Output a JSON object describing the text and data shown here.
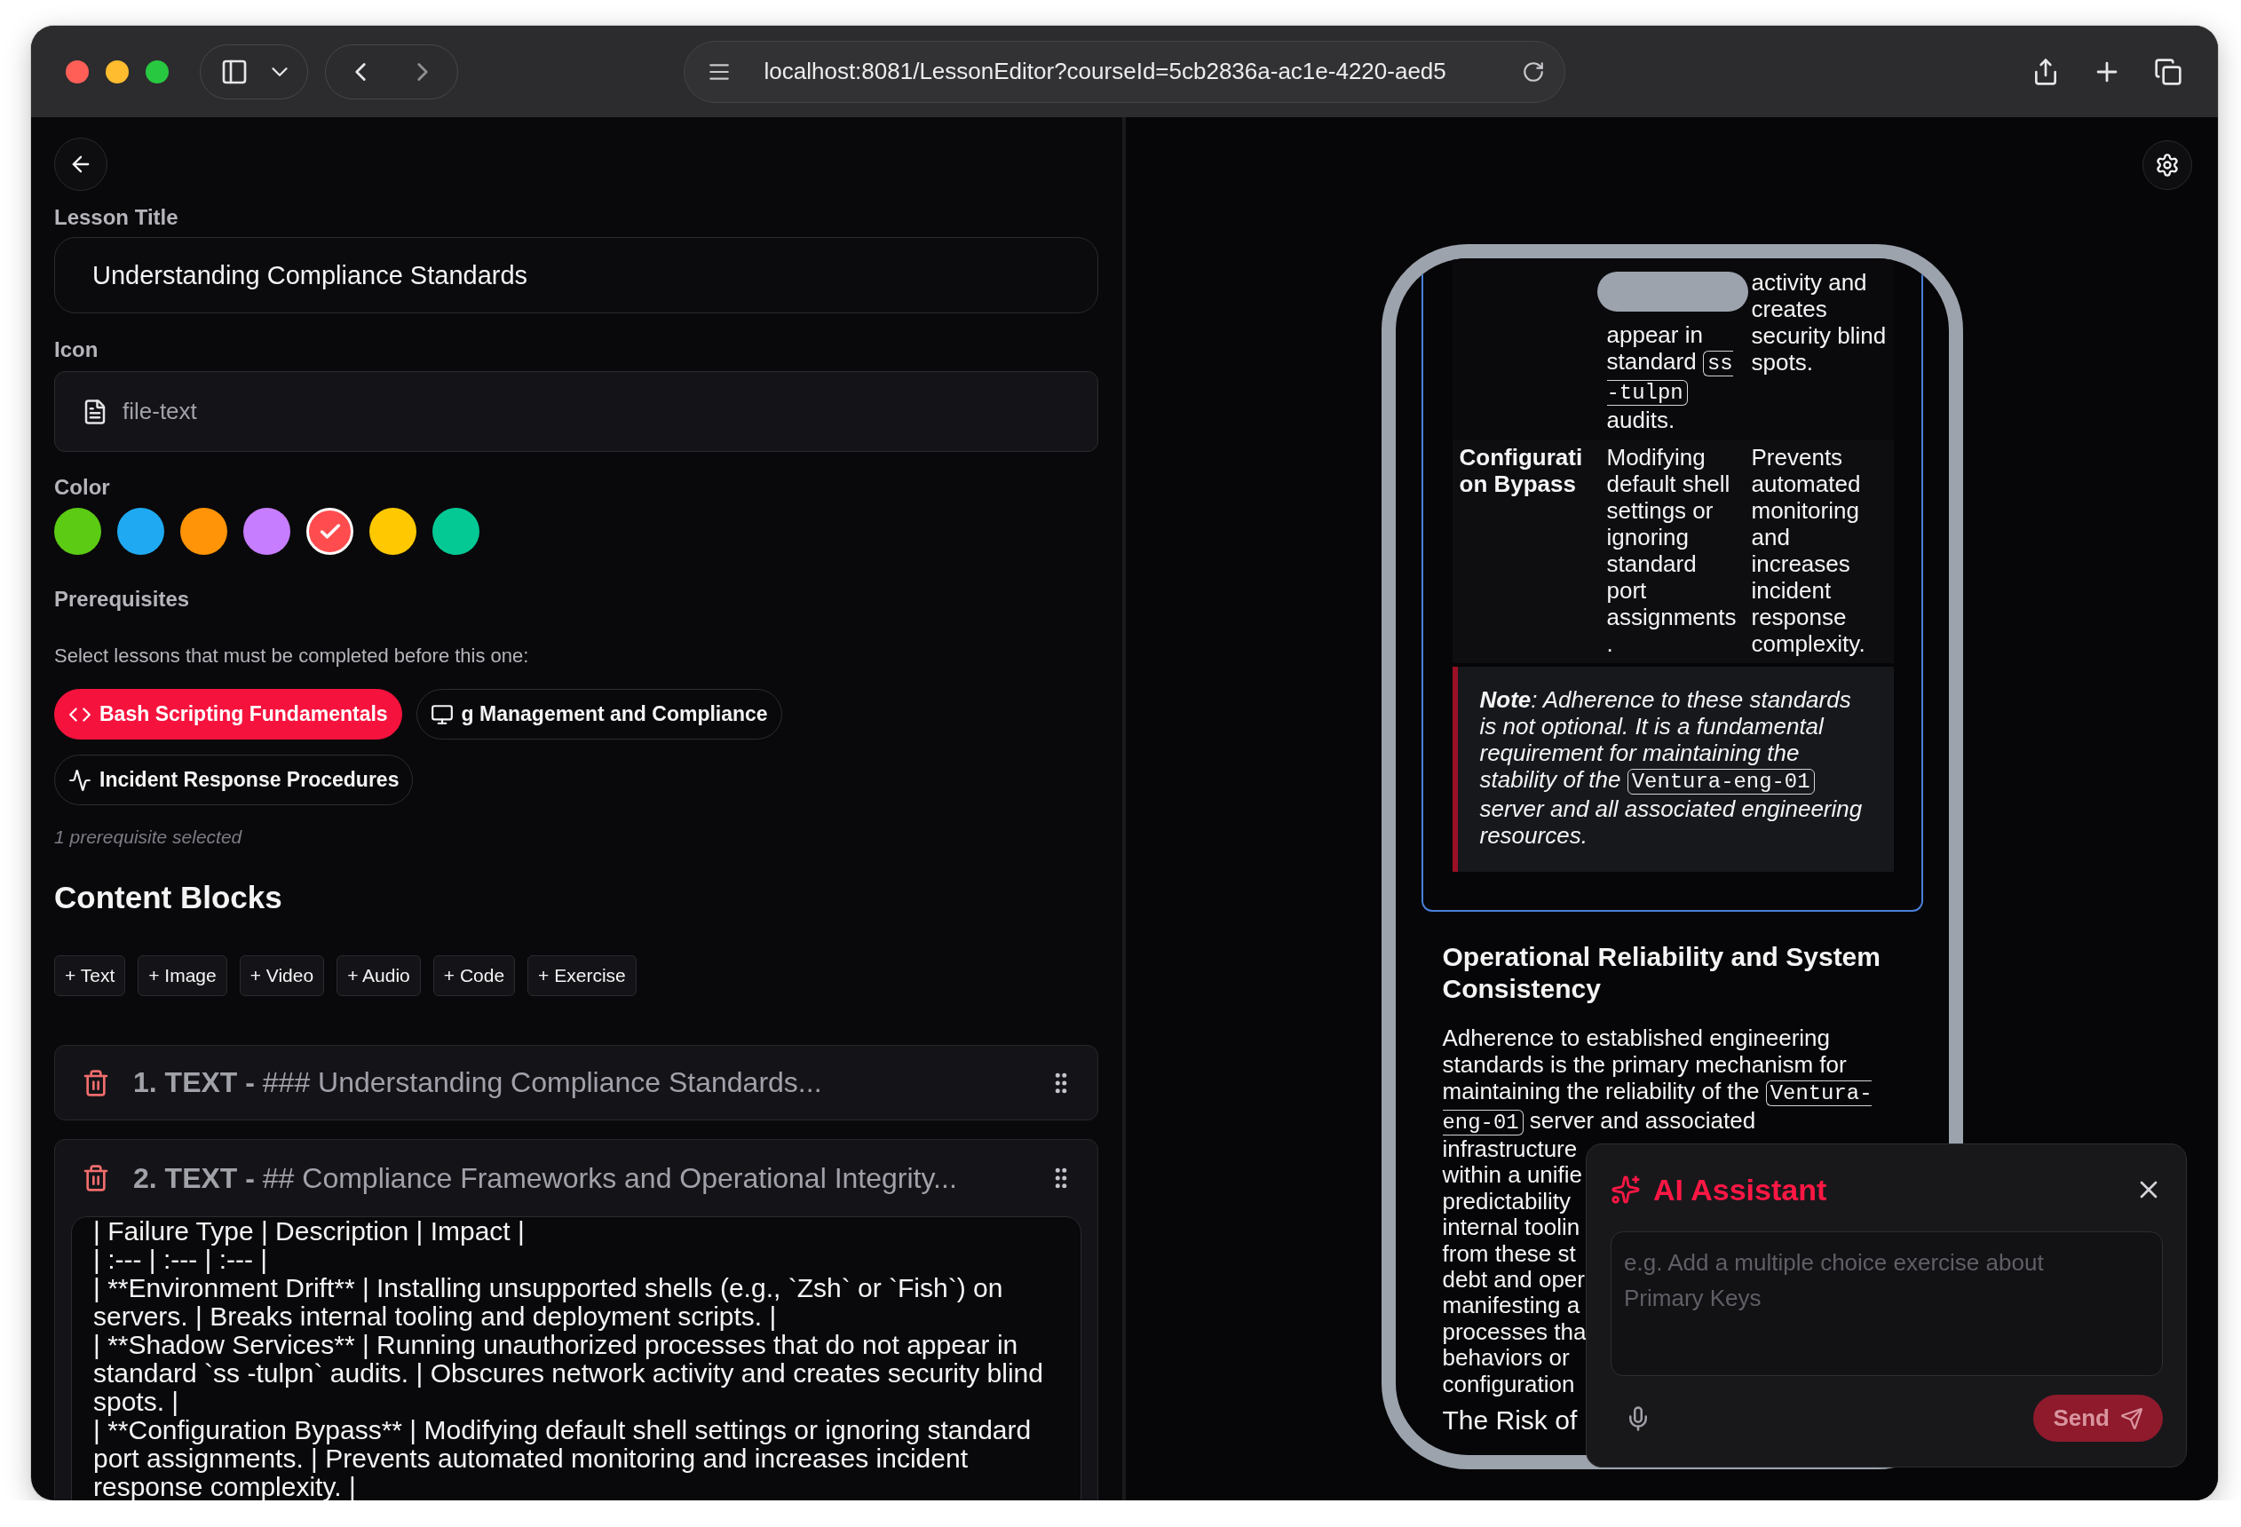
{
  "browser": {
    "url": "localhost:8081/LessonEditor?courseId=5cb2836a-ac1e-4220-aed5"
  },
  "editor": {
    "lesson_title": {
      "label": "Lesson Title",
      "value": "Understanding Compliance Standards"
    },
    "icon": {
      "label": "Icon",
      "value": "file-text"
    },
    "color": {
      "label": "Color",
      "swatches": [
        {
          "color": "#5ccb14",
          "selected": false
        },
        {
          "color": "#1fa9f2",
          "selected": false
        },
        {
          "color": "#ff9408",
          "selected": false
        },
        {
          "color": "#c77dff",
          "selected": false
        },
        {
          "color": "#ff4d4f",
          "selected": true
        },
        {
          "color": "#ffc800",
          "selected": false
        },
        {
          "color": "#05c995",
          "selected": false
        }
      ]
    },
    "prerequisites": {
      "label": "Prerequisites",
      "hint": "Select lessons that must be completed before this one:",
      "chips": [
        {
          "kind": "code",
          "label": "Bash Scripting Fundamentals",
          "selected": true
        },
        {
          "kind": "monitor",
          "label": "g Management and Compliance",
          "selected": false
        },
        {
          "kind": "activity",
          "label": "Incident Response Procedures",
          "selected": false
        }
      ],
      "count": "1 prerequisite selected"
    },
    "content_blocks": {
      "heading": "Content Blocks",
      "add_buttons": [
        "+ Text",
        "+ Image",
        "+ Video",
        "+ Audio",
        "+ Code",
        "+ Exercise"
      ],
      "blocks": [
        {
          "title": "**1. TEXT -** ### Understanding Compliance Standards...",
          "expanded": false
        },
        {
          "title": "**2. TEXT -** ## Compliance Frameworks and Operational Integrity...",
          "expanded": true,
          "content": "| Failure Type | Description | Impact |\n| :--- | :--- | :--- |\n| **Environment Drift** | Installing unsupported shells (e.g., `Zsh` or `Fish`) on servers. | Breaks internal tooling and deployment scripts. |\n| **Shadow Services** | Running unauthorized processes that do not appear in standard `ss -tulpn` audits. | Obscures network activity and creates security blind spots. |\n| **Configuration Bypass** | Modifying default shell settings or ignoring standard port assignments. | Prevents automated monitoring and increases incident response complexity. |"
        }
      ]
    }
  },
  "preview": {
    "table_rows": [
      {
        "description": [
          {
            "kind": "text",
            "text": "appear in standard "
          },
          {
            "kind": "code",
            "text": "ss -tulpn"
          },
          {
            "kind": "text",
            "text": " audits."
          }
        ],
        "impact": [
          {
            "kind": "text",
            "text": "activity and creates security blind spots."
          }
        ]
      },
      {
        "term": "Configuration Bypass",
        "description": [
          {
            "kind": "text",
            "text": "Modifying default shell settings or ignoring standard port assignments."
          }
        ],
        "impact": [
          {
            "kind": "text",
            "text": "Prevents automated monitoring and increases incident response complexity."
          }
        ]
      }
    ],
    "note": [
      {
        "kind": "text",
        "text": "**Note**: Adherence to these standards is not optional. It is a fundamental requirement for maintaining the stability of the "
      },
      {
        "kind": "code",
        "text": "Ventura-eng-01"
      },
      {
        "kind": "text",
        "text": " server and all associated engineering resources."
      }
    ],
    "heading": "Operational Reliability and System Consistency",
    "paragraph": [
      {
        "kind": "text",
        "text": "Adherence to established engineering standards is the primary mechanism for maintaining the reliability of the "
      },
      {
        "kind": "code",
        "text": "Ventura-eng-01"
      },
      {
        "kind": "text",
        "text": " server and associated"
      }
    ],
    "paragraph_lines": [
      "infrastructure",
      "within a unifie",
      "predictability",
      "internal toolin",
      "from these st",
      "debt and oper",
      "manifesting a",
      "processes tha",
      "behaviors or",
      "configuration"
    ],
    "next_heading": "The Risk of"
  },
  "ai_assistant": {
    "title": "AI Assistant",
    "placeholder": "e.g. Add a multiple choice exercise about Primary Keys",
    "send": {
      "label": "Send",
      "disabled": true
    }
  }
}
